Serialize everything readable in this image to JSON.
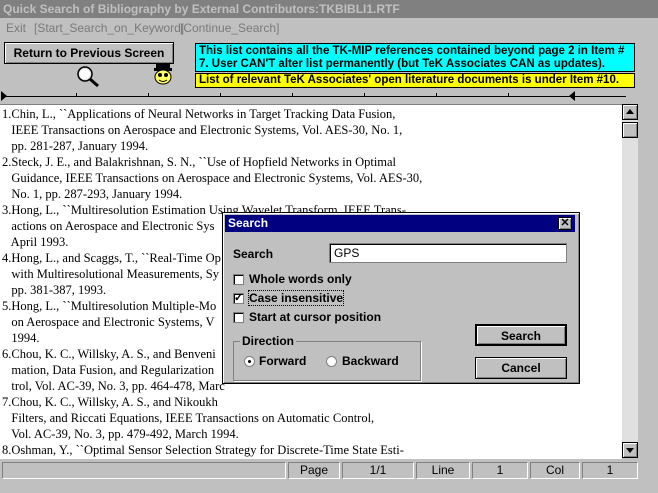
{
  "window": {
    "title": "Quick Search of Bibliography by External Contributors:TKBIBLI1.RTF"
  },
  "menu": {
    "items": [
      "Exit",
      "[Start_Search_on_Keyword]",
      "[Continue_Search]"
    ]
  },
  "toolbar": {
    "return_label": "Return to Previous Screen",
    "info_line1": "This list contains all the TK-MIP references contained beyond page 2 in Item # 7. User CAN'T alter list permanently (but TeK Associates CAN as updates).",
    "info_line2": "List of relevant TeK Associates' open literature documents is under Item #10."
  },
  "document": {
    "lines": [
      "1.Chin, L., ``Applications of Neural Networks in Target Tracking Data Fusion,",
      "   IEEE Transactions on Aerospace and Electronic Systems, Vol. AES-30, No. 1,",
      "   pp. 281-287, January 1994.",
      "2.Steck, J. E., and Balakrishnan, S. N., ``Use of Hopfield Networks in Optimal",
      "   Guidance, IEEE Transactions on Aerospace and Electronic Systems, Vol. AES-30,",
      "   No. 1, pp. 287-293, January 1994.",
      "3.Hong, L., ``Multiresolution Estimation Using Wavelet Transform, IEEE Trans-",
      "   actions on Aerospace and Electronic Sys",
      "   April 1993.",
      "4.Hong, L., and Scaggs, T., ``Real-Time Op",
      "   with Multiresolutional Measurements, Sy",
      "   pp. 381-387, 1993.",
      "5.Hong, L., ``Multiresolution Multiple-Mo",
      "   on Aerospace and Electronic Systems, V",
      "   1994.",
      "6.Chou, K. C., Willsky, A. S., and Benveni",
      "   mation, Data Fusion, and Regularization",
      "   trol, Vol. AC-39, No. 3, pp. 464-478, Marc",
      "7.Chou, K. C., Willsky, A. S., and Nikoukh",
      "   Filters, and Riccati Equations, IEEE Transactions on Automatic Control,",
      "   Vol. AC-39, No. 3, pp. 479-492, March 1994.",
      "8.Oshman, Y., ``Optimal Sensor Selection Strategy for Discrete-Time State Esti-"
    ]
  },
  "status": {
    "page_label": "Page",
    "page_value": "1/1",
    "line_label": "Line",
    "line_value": "1",
    "col_label": "Col",
    "col_value": "1"
  },
  "dialog": {
    "title": "Search",
    "close_glyph": "✕",
    "search_label": "Search",
    "search_value": "GPS",
    "options": [
      {
        "label": "Whole words only",
        "checked": false
      },
      {
        "label": "Case insensitive",
        "checked": true
      },
      {
        "label": "Start at cursor position",
        "checked": false
      }
    ],
    "direction_label": "Direction",
    "forward_label": "Forward",
    "backward_label": "Backward",
    "direction_selected": "Forward",
    "search_button": "Search",
    "cancel_button": "Cancel"
  },
  "colors": {
    "info1_bg": "#00ffff",
    "info2_bg": "#ffff00",
    "dialog_title_bg": "#000080"
  }
}
